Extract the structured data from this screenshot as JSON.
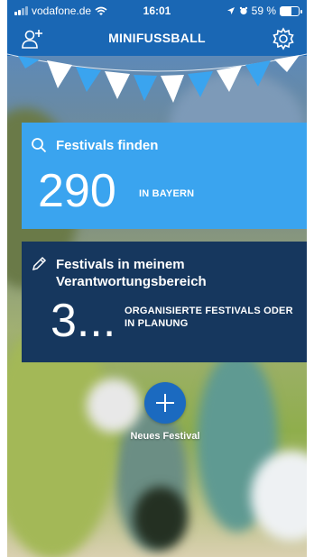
{
  "status_bar": {
    "carrier": "vodafone.de",
    "time": "16:01",
    "battery_percent": "59 %",
    "battery_level": 0.59
  },
  "header": {
    "title": "MINIFUSSBALL",
    "left_icon": "add-user-icon",
    "right_icon": "gear-icon"
  },
  "cards": {
    "find": {
      "title": "Festivals finden",
      "icon": "search-icon",
      "count": "290",
      "count_label": "IN BAYERN",
      "color": "#3aa4ef"
    },
    "responsibility": {
      "title_line1": "Festivals in meinem",
      "title_line2": "Verantwortungsbereich",
      "icon": "pencil-icon",
      "count": "3...",
      "count_label_line1": "ORGANISIERTE FESTIVALS ODER",
      "count_label_line2": "IN PLANUNG",
      "color": "#16375e"
    }
  },
  "fab": {
    "icon": "plus-icon",
    "label": "Neues Festival"
  },
  "colors": {
    "brand_blue": "#1a67b4",
    "flag_white": "#ffffff",
    "flag_blue": "#3aa4ef"
  }
}
